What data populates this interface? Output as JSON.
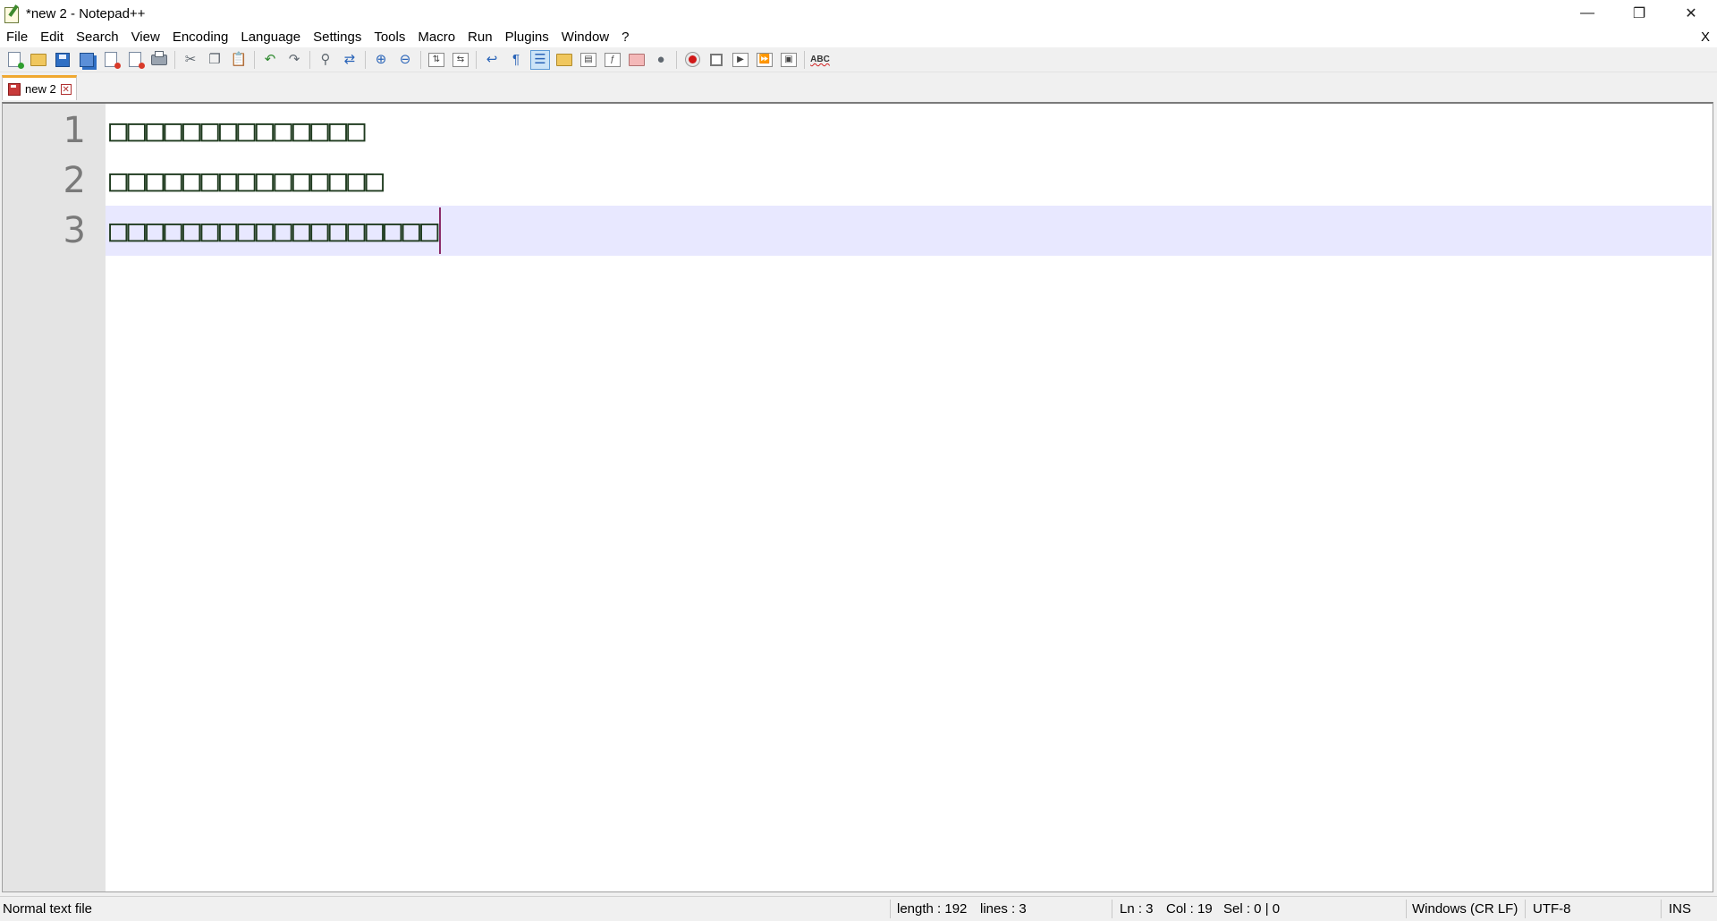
{
  "window": {
    "title": "*new 2 - Notepad++",
    "controls": {
      "minimize": "—",
      "maximize": "❐",
      "close": "✕"
    }
  },
  "menu": {
    "items": [
      "File",
      "Edit",
      "Search",
      "View",
      "Encoding",
      "Language",
      "Settings",
      "Tools",
      "Macro",
      "Run",
      "Plugins",
      "Window",
      "?"
    ],
    "close_document": "X"
  },
  "toolbar": {
    "buttons": [
      "new-file",
      "open-file",
      "save",
      "save-all",
      "close",
      "close-all",
      "print",
      "cut",
      "copy",
      "paste",
      "undo",
      "redo",
      "find",
      "replace",
      "zoom-in",
      "zoom-out",
      "sync-vertical",
      "sync-horizontal",
      "word-wrap",
      "show-all-characters",
      "indent-guide",
      "user-defined-language",
      "document-map",
      "function-list",
      "folder-as-workspace",
      "document-monitor",
      "start-recording",
      "stop-recording",
      "playback",
      "run-macro-multiple",
      "save-macro",
      "spell-check"
    ],
    "active_button": "indent-guide"
  },
  "tabs": [
    {
      "label": "new 2",
      "modified": true,
      "active": true
    }
  ],
  "editor": {
    "lines": [
      {
        "number": "1",
        "text": "□□□□□□□□□□□□□□"
      },
      {
        "number": "2",
        "text": "□□□□□□□□□□□□□□□"
      },
      {
        "number": "3",
        "text": "□□□□□□□□□□□□□□□□□□"
      }
    ],
    "current_line": 3,
    "current_line_color": "#e8e8ff",
    "caret_color": "#8a2a6a"
  },
  "status": {
    "file_type": "Normal text file",
    "length": "length : 192",
    "lines": "lines : 3",
    "ln": "Ln : 3",
    "col": "Col : 19",
    "sel": "Sel : 0 | 0",
    "eol": "Windows (CR LF)",
    "encoding": "UTF-8",
    "mode": "INS"
  }
}
